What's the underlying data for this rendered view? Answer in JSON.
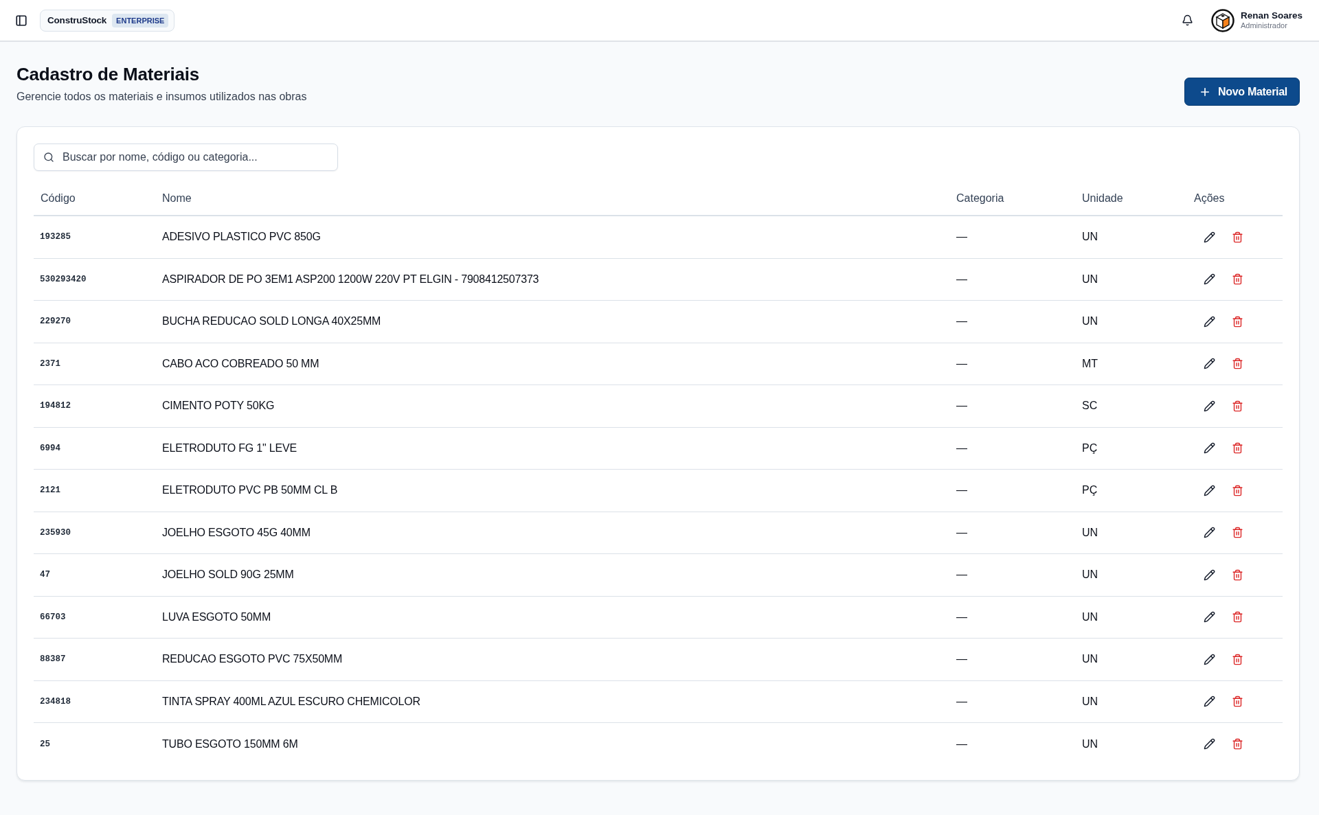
{
  "header": {
    "brand": {
      "name": "ConstruStock",
      "badge": "ENTERPRISE"
    },
    "user": {
      "name": "Renan Soares",
      "role": "Administrador"
    }
  },
  "page": {
    "title": "Cadastro de Materiais",
    "subtitle": "Gerencie todos os materiais e insumos utilizados nas obras",
    "action": "Novo Material"
  },
  "search": {
    "placeholder": "Buscar por nome, código ou categoria..."
  },
  "table": {
    "columns": [
      "Código",
      "Nome",
      "Categoria",
      "Unidade",
      "Ações"
    ],
    "rows": [
      {
        "code": "193285",
        "name": "ADESIVO PLASTICO PVC 850G",
        "category": "—",
        "unit": "UN"
      },
      {
        "code": "530293420",
        "name": "ASPIRADOR DE PO 3EM1 ASP200 1200W 220V PT ELGIN - 7908412507373",
        "category": "—",
        "unit": "UN"
      },
      {
        "code": "229270",
        "name": "BUCHA REDUCAO SOLD LONGA 40X25MM",
        "category": "—",
        "unit": "UN"
      },
      {
        "code": "2371",
        "name": "CABO ACO COBREADO 50 MM",
        "category": "—",
        "unit": "MT"
      },
      {
        "code": "194812",
        "name": "CIMENTO POTY 50KG",
        "category": "—",
        "unit": "SC"
      },
      {
        "code": "6994",
        "name": "ELETRODUTO FG 1\" LEVE",
        "category": "—",
        "unit": "PÇ"
      },
      {
        "code": "2121",
        "name": "ELETRODUTO PVC PB 50MM CL B",
        "category": "—",
        "unit": "PÇ"
      },
      {
        "code": "235930",
        "name": "JOELHO ESGOTO 45G 40MM",
        "category": "—",
        "unit": "UN"
      },
      {
        "code": "47",
        "name": "JOELHO SOLD 90G 25MM",
        "category": "—",
        "unit": "UN"
      },
      {
        "code": "66703",
        "name": "LUVA ESGOTO 50MM",
        "category": "—",
        "unit": "UN"
      },
      {
        "code": "88387",
        "name": "REDUCAO ESGOTO PVC 75X50MM",
        "category": "—",
        "unit": "UN"
      },
      {
        "code": "234818",
        "name": "TINTA SPRAY 400ML AZUL ESCURO CHEMICOLOR",
        "category": "—",
        "unit": "UN"
      },
      {
        "code": "25",
        "name": "TUBO ESGOTO 150MM 6M",
        "category": "—",
        "unit": "UN"
      }
    ]
  }
}
